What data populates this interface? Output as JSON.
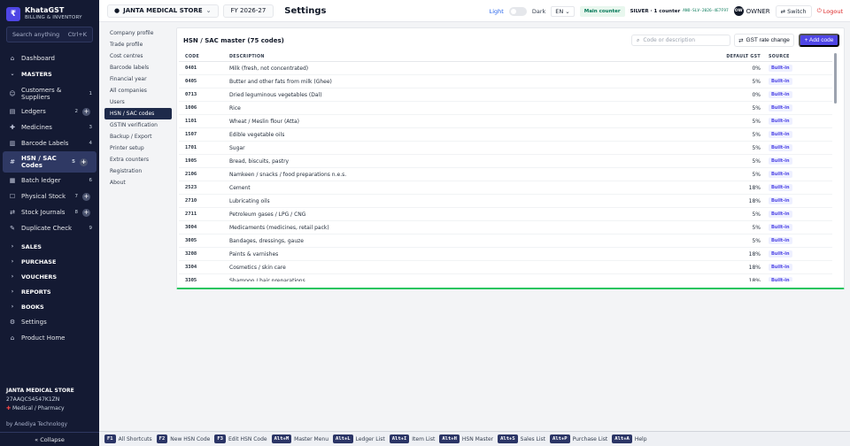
{
  "brand": {
    "logo_letter": "₹",
    "name": "KhataGST",
    "sub": "BILLING & INVENTORY"
  },
  "search": {
    "placeholder": "Search anything",
    "shortcut": "Ctrl+K"
  },
  "nav": [
    {
      "label": "Dashboard",
      "icon": "⌂",
      "kind": "item"
    },
    {
      "label": "MASTERS",
      "icon": "⌄",
      "kind": "section"
    },
    {
      "label": "Customers & Suppliers",
      "icon": "☺",
      "kind": "item",
      "badge": "1",
      "two_line": true
    },
    {
      "label": "Ledgers",
      "icon": "▤",
      "kind": "item",
      "badge": "2",
      "plus": true
    },
    {
      "label": "Medicines",
      "icon": "✚",
      "kind": "item",
      "badge": "3"
    },
    {
      "label": "Barcode Labels",
      "icon": "▥",
      "kind": "item",
      "badge": "4"
    },
    {
      "label": "HSN / SAC Codes",
      "icon": "#",
      "kind": "item",
      "badge": "5",
      "plus": true,
      "active": true
    },
    {
      "label": "Batch ledger",
      "icon": "▦",
      "kind": "item",
      "badge": "6"
    },
    {
      "label": "Physical Stock",
      "icon": "☐",
      "kind": "item",
      "badge": "7",
      "plus": true
    },
    {
      "label": "Stock Journals",
      "icon": "⇄",
      "kind": "item",
      "badge": "8",
      "plus": true
    },
    {
      "label": "Duplicate Check",
      "icon": "✎",
      "kind": "item",
      "badge": "9"
    },
    {
      "label": "SALES",
      "icon": "›",
      "kind": "section"
    },
    {
      "label": "PURCHASE",
      "icon": "›",
      "kind": "section"
    },
    {
      "label": "VOUCHERS",
      "icon": "›",
      "kind": "section"
    },
    {
      "label": "REPORTS",
      "icon": "›",
      "kind": "section"
    },
    {
      "label": "BOOKS",
      "icon": "›",
      "kind": "section"
    },
    {
      "label": "Settings",
      "icon": "⚙",
      "kind": "item"
    },
    {
      "label": "Product Home",
      "icon": "⌂",
      "kind": "item"
    }
  ],
  "org": {
    "name": "JANTA MEDICAL STORE",
    "gstin": "27AAQCS4547K1ZN",
    "type": "Medical / Pharmacy",
    "type_icon": "✚"
  },
  "by_line": "by Anediya Technology",
  "collapse_label": "« Collapse",
  "topbar": {
    "company": "JANTA MEDICAL STORE",
    "fy": "FY 2026-27",
    "page_title": "Settings",
    "light": "Light",
    "dark": "Dark",
    "lang": "EN",
    "counter": "Main counter",
    "plan": "SILVER · 1 counter",
    "plan_code": "ANO-SLV-2026-4E7F97",
    "avatar": "OW",
    "user": "OWNER",
    "switch": "Switch",
    "logout": "Logout"
  },
  "settings_nav": [
    {
      "label": "Company profile"
    },
    {
      "label": "Trade profile"
    },
    {
      "label": "Cost centres"
    },
    {
      "label": "Barcode labels"
    },
    {
      "label": "Financial year"
    },
    {
      "label": "All companies"
    },
    {
      "label": "Users"
    },
    {
      "label": "HSN / SAC codes",
      "active": true
    },
    {
      "label": "GSTIN verification"
    },
    {
      "label": "Backup / Export"
    },
    {
      "label": "Printer setup"
    },
    {
      "label": "Extra counters"
    },
    {
      "label": "Registration"
    },
    {
      "label": "About"
    }
  ],
  "panel": {
    "title": "HSN / SAC master (75 codes)",
    "search_placeholder": "Code or description",
    "rate_button": "GST rate change",
    "add_button": "+ Add code",
    "columns": {
      "code": "CODE",
      "description": "DESCRIPTION",
      "gst": "DEFAULT GST",
      "source": "SOURCE"
    },
    "rows": [
      {
        "code": "0401",
        "description": "Milk (fresh, not concentrated)",
        "gst": "0%",
        "source": "Built-in"
      },
      {
        "code": "0405",
        "description": "Butter and other fats from milk (Ghee)",
        "gst": "5%",
        "source": "Built-in"
      },
      {
        "code": "0713",
        "description": "Dried leguminous vegetables (Dal)",
        "gst": "0%",
        "source": "Built-in"
      },
      {
        "code": "1006",
        "description": "Rice",
        "gst": "5%",
        "source": "Built-in"
      },
      {
        "code": "1101",
        "description": "Wheat / Meslin flour (Atta)",
        "gst": "5%",
        "source": "Built-in"
      },
      {
        "code": "1507",
        "description": "Edible vegetable oils",
        "gst": "5%",
        "source": "Built-in"
      },
      {
        "code": "1701",
        "description": "Sugar",
        "gst": "5%",
        "source": "Built-in"
      },
      {
        "code": "1905",
        "description": "Bread, biscuits, pastry",
        "gst": "5%",
        "source": "Built-in"
      },
      {
        "code": "2106",
        "description": "Namkeen / snacks / food preparations n.e.s.",
        "gst": "5%",
        "source": "Built-in"
      },
      {
        "code": "2523",
        "description": "Cement",
        "gst": "18%",
        "source": "Built-in"
      },
      {
        "code": "2710",
        "description": "Lubricating oils",
        "gst": "18%",
        "source": "Built-in"
      },
      {
        "code": "2711",
        "description": "Petroleum gases / LPG / CNG",
        "gst": "5%",
        "source": "Built-in"
      },
      {
        "code": "3004",
        "description": "Medicaments (medicines, retail pack)",
        "gst": "5%",
        "source": "Built-in"
      },
      {
        "code": "3005",
        "description": "Bandages, dressings, gauze",
        "gst": "5%",
        "source": "Built-in"
      },
      {
        "code": "3208",
        "description": "Paints & varnishes",
        "gst": "18%",
        "source": "Built-in"
      },
      {
        "code": "3304",
        "description": "Cosmetics / skin care",
        "gst": "18%",
        "source": "Built-in"
      },
      {
        "code": "3305",
        "description": "Shampoo / hair preparations",
        "gst": "18%",
        "source": "Built-in"
      }
    ]
  },
  "footer": [
    {
      "key": "F1",
      "label": "All Shortcuts"
    },
    {
      "key": "F2",
      "label": "New HSN Code"
    },
    {
      "key": "F3",
      "label": "Edit HSN Code"
    },
    {
      "key": "Alt+M",
      "label": "Master Menu"
    },
    {
      "key": "Alt+L",
      "label": "Ledger List"
    },
    {
      "key": "Alt+I",
      "label": "Item List"
    },
    {
      "key": "Alt+H",
      "label": "HSN Master"
    },
    {
      "key": "Alt+S",
      "label": "Sales List"
    },
    {
      "key": "Alt+P",
      "label": "Purchase List"
    },
    {
      "key": "Alt+A",
      "label": "Help"
    }
  ],
  "icons": {
    "search": "search-icon",
    "switch": "switch-icon",
    "logout": "logout-icon",
    "rate": "swap-icon"
  },
  "colors": {
    "sidebar": "#141a33",
    "accent": "#4f46e5",
    "panel_border": "#22c55e",
    "logout": "#dc2626"
  }
}
